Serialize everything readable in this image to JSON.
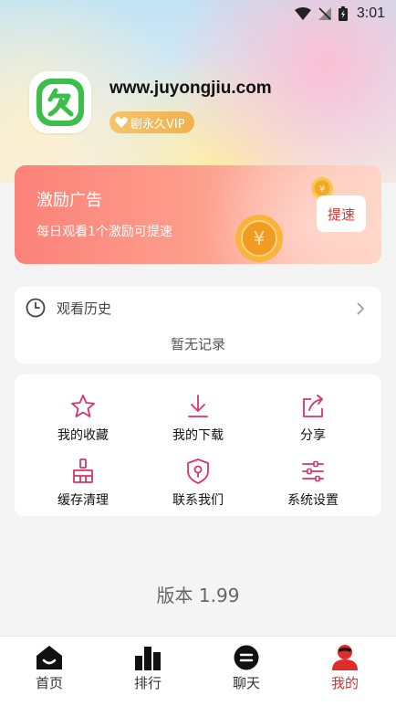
{
  "status_bar": {
    "time": "3:01"
  },
  "profile": {
    "site_name": "www.juyongjiu.com",
    "vip_label": "剧永久VIP"
  },
  "ad": {
    "title": "激励广告",
    "subtitle": "每日观看1个激励可提速",
    "button_label": "提速"
  },
  "history": {
    "title": "观看历史",
    "empty_text": "暂无记录"
  },
  "features": [
    {
      "label": "我的收藏",
      "icon": "star-icon"
    },
    {
      "label": "我的下载",
      "icon": "download-icon"
    },
    {
      "label": "分享",
      "icon": "share-icon"
    },
    {
      "label": "缓存清理",
      "icon": "broom-icon"
    },
    {
      "label": "联系我们",
      "icon": "location-shield-icon"
    },
    {
      "label": "系统设置",
      "icon": "sliders-icon"
    }
  ],
  "version_text": "版本 1.99",
  "tabs": [
    {
      "label": "首页",
      "icon": "home-icon"
    },
    {
      "label": "排行",
      "icon": "ranking-icon"
    },
    {
      "label": "聊天",
      "icon": "chat-icon"
    },
    {
      "label": "我的",
      "icon": "user-icon",
      "active": true
    }
  ],
  "colors": {
    "accent": "#e02b2b",
    "icon_pink": "#d9336a",
    "logo_green": "#3cbf4a",
    "vip_gold": "#f2b655"
  }
}
